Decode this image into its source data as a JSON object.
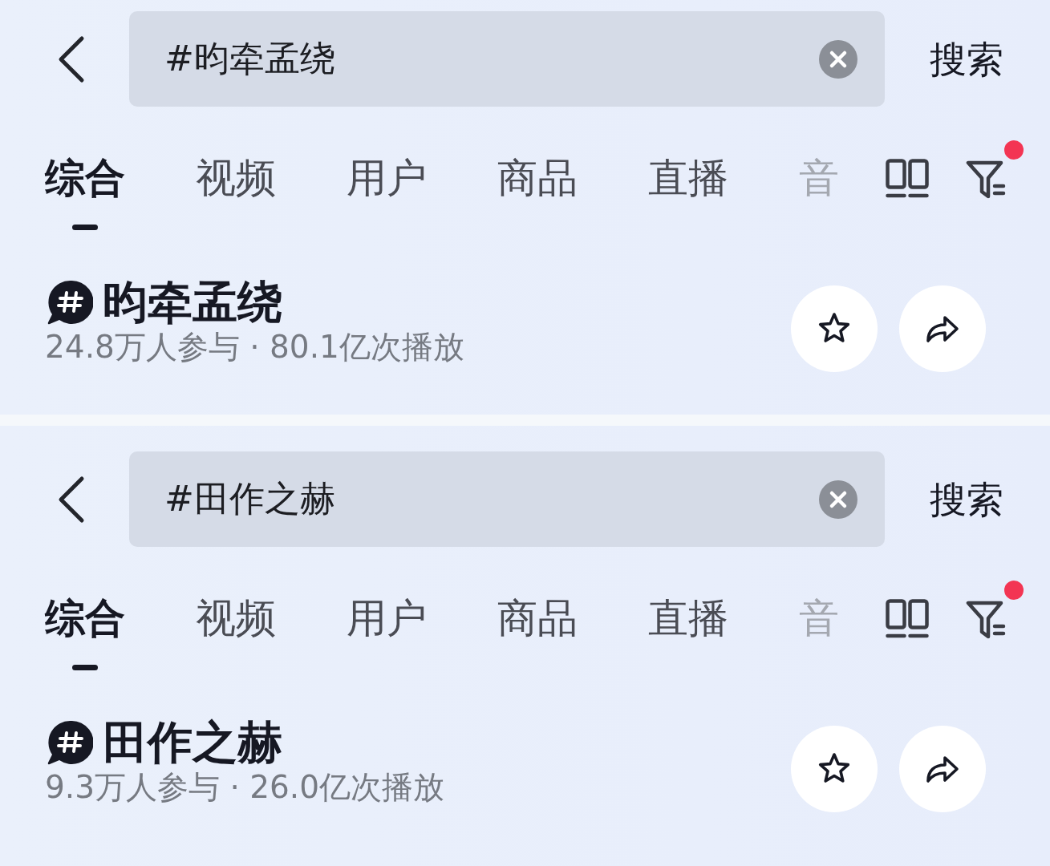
{
  "panels": [
    {
      "search": {
        "query": "#昀牵孟绕",
        "button": "搜索"
      },
      "tabs": [
        {
          "label": "综合",
          "selected": true
        },
        {
          "label": "视频",
          "selected": false
        },
        {
          "label": "用户",
          "selected": false
        },
        {
          "label": "商品",
          "selected": false
        },
        {
          "label": "直播",
          "selected": false
        },
        {
          "label": "音",
          "selected": false
        }
      ],
      "filter": {
        "badge": true
      },
      "topic": {
        "title": "昀牵孟绕",
        "stats": "24.8万人参与 · 80.1亿次播放"
      }
    },
    {
      "search": {
        "query": "#田作之赫",
        "button": "搜索"
      },
      "tabs": [
        {
          "label": "综合",
          "selected": true
        },
        {
          "label": "视频",
          "selected": false
        },
        {
          "label": "用户",
          "selected": false
        },
        {
          "label": "商品",
          "selected": false
        },
        {
          "label": "直播",
          "selected": false
        },
        {
          "label": "音",
          "selected": false
        }
      ],
      "filter": {
        "badge": true
      },
      "topic": {
        "title": "田作之赫",
        "stats": "9.3万人参与 · 26.0亿次播放"
      }
    }
  ]
}
